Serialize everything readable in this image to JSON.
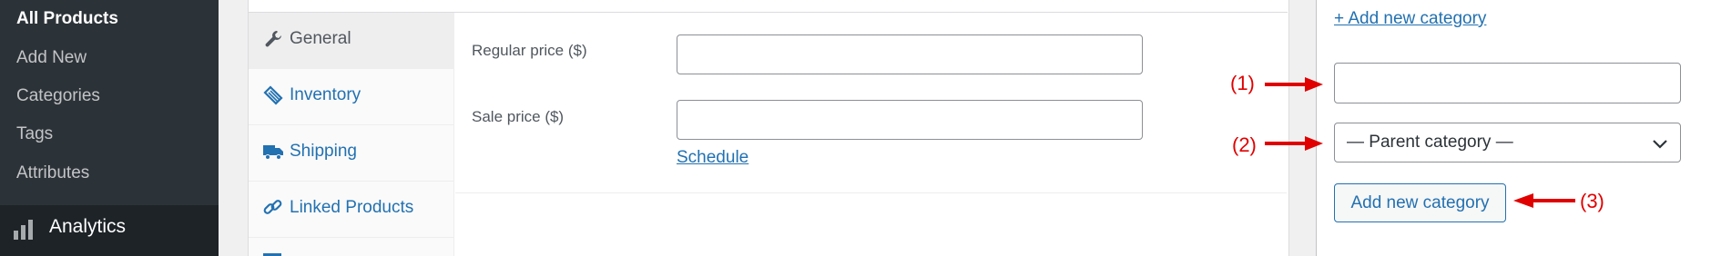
{
  "sidebar": {
    "items": [
      {
        "label": "All Products",
        "current": true
      },
      {
        "label": "Add New"
      },
      {
        "label": "Categories"
      },
      {
        "label": "Tags"
      },
      {
        "label": "Attributes"
      }
    ],
    "analytics": {
      "label": "Analytics",
      "icon": "bar-chart-icon"
    }
  },
  "product_data": {
    "tabs": [
      {
        "label": "General",
        "icon": "wrench-icon",
        "active": true
      },
      {
        "label": "Inventory",
        "icon": "tag-icon"
      },
      {
        "label": "Shipping",
        "icon": "truck-icon"
      },
      {
        "label": "Linked Products",
        "icon": "link-icon"
      }
    ],
    "fields": {
      "regular_price_label": "Regular price ($)",
      "regular_price_value": "",
      "sale_price_label": "Sale price ($)",
      "sale_price_value": "",
      "schedule_link": "Schedule"
    }
  },
  "categories_box": {
    "add_new_link": "+ Add new category",
    "new_category_value": "",
    "parent_select_value": "— Parent category —",
    "add_button_label": "Add new category"
  },
  "annotations": [
    "(1)",
    "(2)",
    "(3)"
  ],
  "colors": {
    "sidebar_bg": "#2c3338",
    "sidebar_active_bg": "#1d2327",
    "link_blue": "#2271b1",
    "annotation_red": "#e00000"
  }
}
